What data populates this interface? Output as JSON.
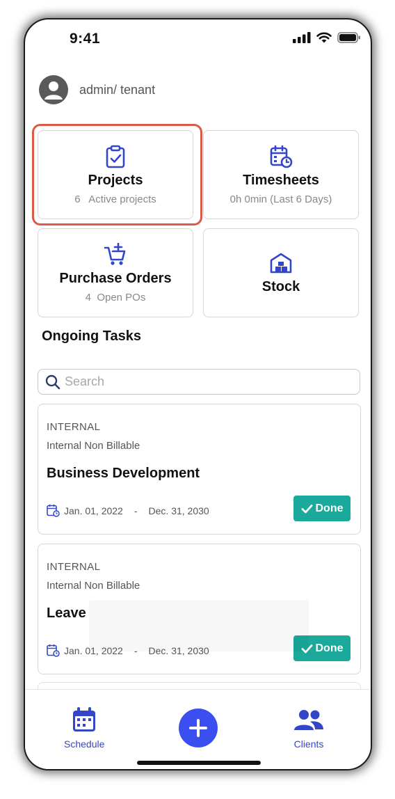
{
  "status_bar": {
    "time": "9:41"
  },
  "header": {
    "user_label": "admin/ tenant"
  },
  "cards": {
    "projects": {
      "title": "Projects",
      "count": "6",
      "subtitle": "Active projects"
    },
    "timesheets": {
      "title": "Timesheets",
      "subtitle": "0h 0min  (Last 6 Days)"
    },
    "purchase_orders": {
      "title": "Purchase Orders",
      "count": "4",
      "subtitle": "Open POs"
    },
    "stock": {
      "title": "Stock"
    }
  },
  "ongoing": {
    "title": "Ongoing Tasks",
    "search_placeholder": "Search",
    "tasks": [
      {
        "category": "INTERNAL",
        "billing": "Internal Non Billable",
        "name": "Business Development",
        "start": "Jan. 01, 2022",
        "dash": "-",
        "end": "Dec. 31, 2030",
        "status": "Done"
      },
      {
        "category": "INTERNAL",
        "billing": "Internal Non Billable",
        "name": "Leave",
        "start": "Jan. 01, 2022",
        "dash": "-",
        "end": "Dec. 31, 2030",
        "status": "Done"
      }
    ]
  },
  "bottom_nav": {
    "schedule": "Schedule",
    "clients": "Clients"
  },
  "colors": {
    "accent": "#3b4ff0",
    "done": "#1aa99a",
    "selection": "#d95b45",
    "icon": "#3346c9"
  }
}
